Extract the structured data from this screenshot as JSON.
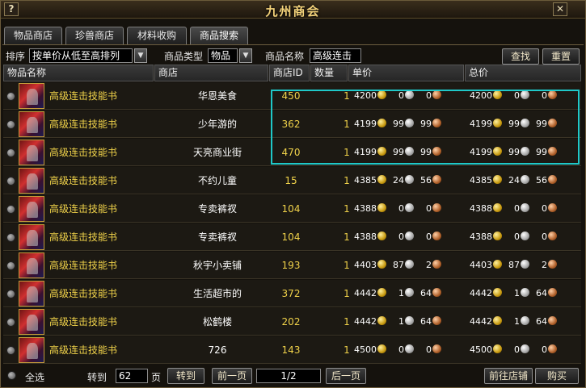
{
  "window": {
    "title": "九州商会",
    "help": "?",
    "close": "✕"
  },
  "tabs": [
    "物品商店",
    "珍兽商店",
    "材料收购",
    "商品搜索"
  ],
  "filter": {
    "sort_label": "排序",
    "sort_value": "按单价从低至高排列",
    "type_label": "商品类型",
    "type_value": "物品",
    "name_label": "商品名称",
    "name_value": "高级连击",
    "search_button": "查找",
    "reset_button": "重置"
  },
  "columns": [
    "物品名称",
    "商店",
    "商店ID",
    "数量",
    "单价",
    "总价"
  ],
  "rows": [
    {
      "name": "高级连击技能书",
      "shop": "华恩美食",
      "shop_id": "450",
      "qty": "1",
      "price": [
        "4200",
        "0",
        "0"
      ],
      "total": [
        "4200",
        "0",
        "0"
      ]
    },
    {
      "name": "高级连击技能书",
      "shop": "少年游的",
      "shop_id": "362",
      "qty": "1",
      "price": [
        "4199",
        "99",
        "99"
      ],
      "total": [
        "4199",
        "99",
        "99"
      ]
    },
    {
      "name": "高级连击技能书",
      "shop": "天亮商业街",
      "shop_id": "470",
      "qty": "1",
      "price": [
        "4199",
        "99",
        "99"
      ],
      "total": [
        "4199",
        "99",
        "99"
      ]
    },
    {
      "name": "高级连击技能书",
      "shop": "不约儿童",
      "shop_id": "15",
      "qty": "1",
      "price": [
        "4385",
        "24",
        "56"
      ],
      "total": [
        "4385",
        "24",
        "56"
      ]
    },
    {
      "name": "高级连击技能书",
      "shop": "专卖裤衩",
      "shop_id": "104",
      "qty": "1",
      "price": [
        "4388",
        "0",
        "0"
      ],
      "total": [
        "4388",
        "0",
        "0"
      ]
    },
    {
      "name": "高级连击技能书",
      "shop": "专卖裤衩",
      "shop_id": "104",
      "qty": "1",
      "price": [
        "4388",
        "0",
        "0"
      ],
      "total": [
        "4388",
        "0",
        "0"
      ]
    },
    {
      "name": "高级连击技能书",
      "shop": "秋宇小卖铺",
      "shop_id": "193",
      "qty": "1",
      "price": [
        "4403",
        "87",
        "2"
      ],
      "total": [
        "4403",
        "87",
        "2"
      ]
    },
    {
      "name": "高级连击技能书",
      "shop": "生活超市的",
      "shop_id": "372",
      "qty": "1",
      "price": [
        "4442",
        "1",
        "64"
      ],
      "total": [
        "4442",
        "1",
        "64"
      ]
    },
    {
      "name": "高级连击技能书",
      "shop": "松鹤楼",
      "shop_id": "202",
      "qty": "1",
      "price": [
        "4442",
        "1",
        "64"
      ],
      "total": [
        "4442",
        "1",
        "64"
      ]
    },
    {
      "name": "高级连击技能书",
      "shop": "726",
      "shop_id": "143",
      "qty": "1",
      "price": [
        "4500",
        "0",
        "0"
      ],
      "total": [
        "4500",
        "0",
        "0"
      ]
    }
  ],
  "footer": {
    "select_all": "全选",
    "goto_label": "转到",
    "page_input": "62",
    "page_unit": "页",
    "goto_button": "转到",
    "prev_button": "前一页",
    "page_indicator": "1/2",
    "next_button": "后一页",
    "visit_shop_button": "前往店铺",
    "buy_button": "购买"
  },
  "colors": {
    "highlight": "#1fc8c8",
    "item_text": "#f0d24a",
    "title": "#f3d27a"
  }
}
